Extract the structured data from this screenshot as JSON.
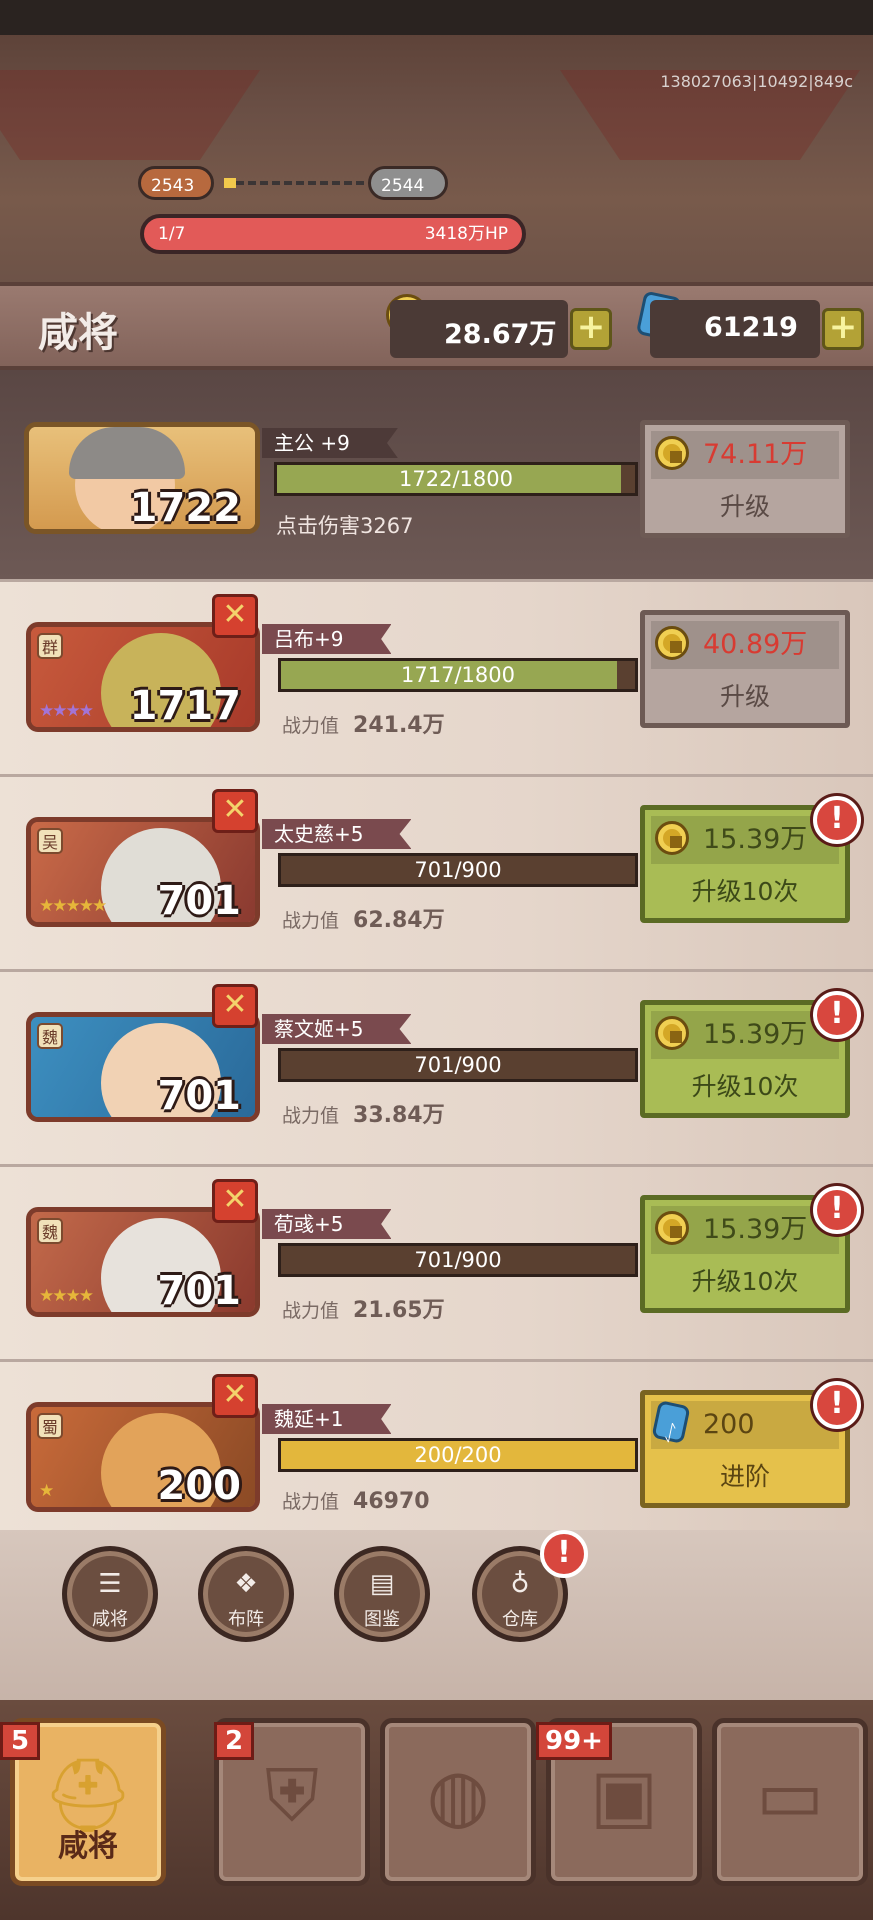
{
  "build_id": "138027063|10492|849c",
  "stage": {
    "current": "2543",
    "next": "2544",
    "wave": "1/7",
    "hp": "3418万HP",
    "hp_fraction": 1.0
  },
  "header": {
    "title": "咸将",
    "gold": "28.67万",
    "gems": "61219"
  },
  "lord": {
    "name": "主公 +9",
    "level": "1722",
    "xp": "1722/1800",
    "xp_fraction": 0.957,
    "stat": "点击伤害3267",
    "cost": "74.11万",
    "action": "升级"
  },
  "generals": [
    {
      "faction": "群",
      "name": "吕布+9",
      "level": "1717",
      "xp": "1717/1800",
      "xp_fraction": 0.954,
      "stat_label": "战力值",
      "stat_value": "241.4万",
      "stars": 4,
      "cost": "40.89万",
      "action": "升级",
      "button": "grey",
      "alert": false
    },
    {
      "faction": "吴",
      "name": "太史慈+5",
      "level": "701",
      "xp": "701/900",
      "xp_fraction": 0.0,
      "stat_label": "战力值",
      "stat_value": "62.84万",
      "stars": 5,
      "cost": "15.39万",
      "action": "升级10次",
      "button": "green",
      "alert": true
    },
    {
      "faction": "魏",
      "name": "蔡文姬+5",
      "level": "701",
      "xp": "701/900",
      "xp_fraction": 0.0,
      "stat_label": "战力值",
      "stat_value": "33.84万",
      "stars": 0,
      "cost": "15.39万",
      "action": "升级10次",
      "button": "green",
      "alert": true
    },
    {
      "faction": "魏",
      "name": "荀彧+5",
      "level": "701",
      "xp": "701/900",
      "xp_fraction": 0.0,
      "stat_label": "战力值",
      "stat_value": "21.65万",
      "stars": 4,
      "cost": "15.39万",
      "action": "升级10次",
      "button": "green",
      "alert": true
    },
    {
      "faction": "蜀",
      "name": "魏延+1",
      "level": "200",
      "xp": "200/200",
      "xp_fraction": 1.0,
      "stat_label": "战力值",
      "stat_value": "46970",
      "stars": 1,
      "cost": "200",
      "action": "进阶",
      "button": "yellow",
      "alert": true
    }
  ],
  "quick_buttons": [
    {
      "label": "咸将",
      "icon": "list-icon"
    },
    {
      "label": "布阵",
      "icon": "formation-icon"
    },
    {
      "label": "图鉴",
      "icon": "book-icon"
    },
    {
      "label": "仓库",
      "icon": "bag-icon"
    }
  ],
  "tabs": [
    {
      "label": "咸将",
      "badge": "5",
      "icon": "helmet-icon"
    },
    {
      "label": "",
      "badge": "2",
      "icon": "armor-icon"
    },
    {
      "label": "",
      "badge": "",
      "icon": "shell-icon"
    },
    {
      "label": "",
      "badge": "99+",
      "icon": "chest-icon"
    },
    {
      "label": "",
      "badge": "",
      "icon": "scroll-icon"
    }
  ],
  "colors": {
    "hp": "#e25a58",
    "xp": "#97a752",
    "xp_full": "#e3b73c",
    "cost_red": "#d83b32"
  }
}
